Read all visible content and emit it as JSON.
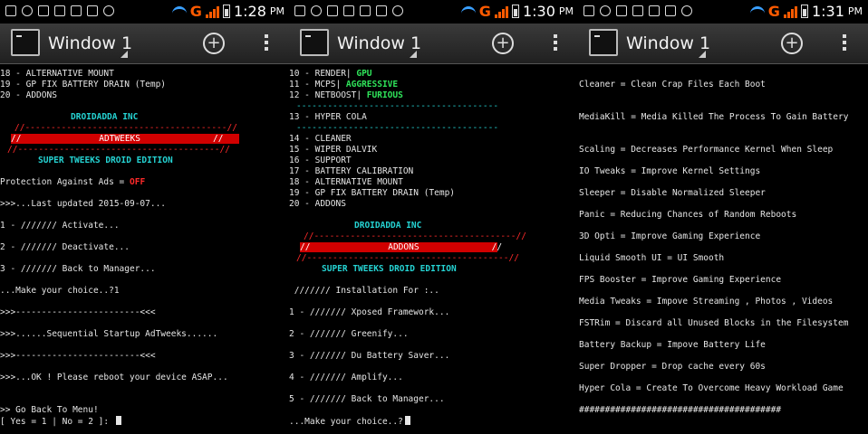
{
  "panels": [
    {
      "time": "1:28",
      "ampm": "PM",
      "window_title": "Window 1",
      "lines": [
        "18 - ALTERNATIVE MOUNT",
        "19 - GP FIX BATTERY DRAIN (Temp)",
        "20 - ADDONS",
        "DROIDADDA INC",
        "//---------------------------------------//",
        "//               ADTWEEKS              //",
        "//---------------------------------------//",
        "SUPER TWEEKS DROID EDITION",
        "Protection Against Ads = ",
        "OFF",
        ">>>...Last updated 2015-09-07...",
        "1 - /////// Activate...",
        "2 - /////// Deactivate...",
        "3 - /////// Back to Manager...",
        "...Make your choice..?1",
        ">>>------------------------<<<",
        ">>>......Sequential Startup AdTweeks......",
        ">>>------------------------<<<",
        ">>>...OK ! Please reboot your device ASAP...",
        ">> Go Back To Menu!",
        "[ Yes = 1 | No = 2 ]: "
      ]
    },
    {
      "time": "1:30",
      "ampm": "PM",
      "window_title": "Window 1",
      "lines": [
        "10 - RENDER| ",
        "GPU",
        "11 - MCPS| ",
        "AGGRESSIVE",
        "12 - NETBOOST| ",
        "FURIOUS",
        "---------------------------------------",
        "13 - HYPER COLA",
        "---------------------------------------",
        "14 - CLEANER",
        "15 - WIPER DALVIK",
        "16 - SUPPORT",
        "17 - BATTERY CALIBRATION",
        "18 - ALTERNATIVE MOUNT",
        "19 - GP FIX BATTERY DRAIN (Temp)",
        "20 - ADDONS",
        "DROIDADDA INC",
        "//---------------------------------------//",
        "//               ADDONS              //",
        "//---------------------------------------//",
        "SUPER TWEEKS DROID EDITION",
        " /////// Installation For :..",
        "1 - /////// Xposed Framework...",
        "2 - /////// Greenify...",
        "3 - /////// Du Battery Saver...",
        "4 - /////// Amplify...",
        "5 - /////// Back to Manager...",
        "...Make your choice..?"
      ]
    },
    {
      "time": "1:31",
      "ampm": "PM",
      "window_title": "Window 1",
      "lines": [
        "Cleaner = Clean Crap Files Each Boot",
        "MediaKill = Media Killed The Process To Gain Battery",
        "Scaling = Decreases Performance Kernel When Sleep",
        "IO Tweaks = Improve Kernel Settings",
        "Sleeper = Disable Normalized Sleeper",
        "Panic = Reducing Chances of Random Reboots",
        "3D Opti = Improve Gaming Experience",
        "Liquid Smooth UI = UI Smooth",
        "FPS Booster = Improve Gaming Experience",
        "Media Tweaks = Impove Streaming , Photos , Videos",
        "FSTRim = Discard all Unused Blocks in the Filesystem",
        "Battery Backup = Impove Battery Life",
        "Super Dropper = Drop cache every 60s",
        "Hyper Cola = Create To Overcome Heavy Workload Game",
        "#######################################"
      ]
    }
  ],
  "colors": {
    "cyan": "#25d3d3",
    "green": "#2fe45a",
    "red": "#ff2a2a",
    "bar_red": "#d10000"
  }
}
